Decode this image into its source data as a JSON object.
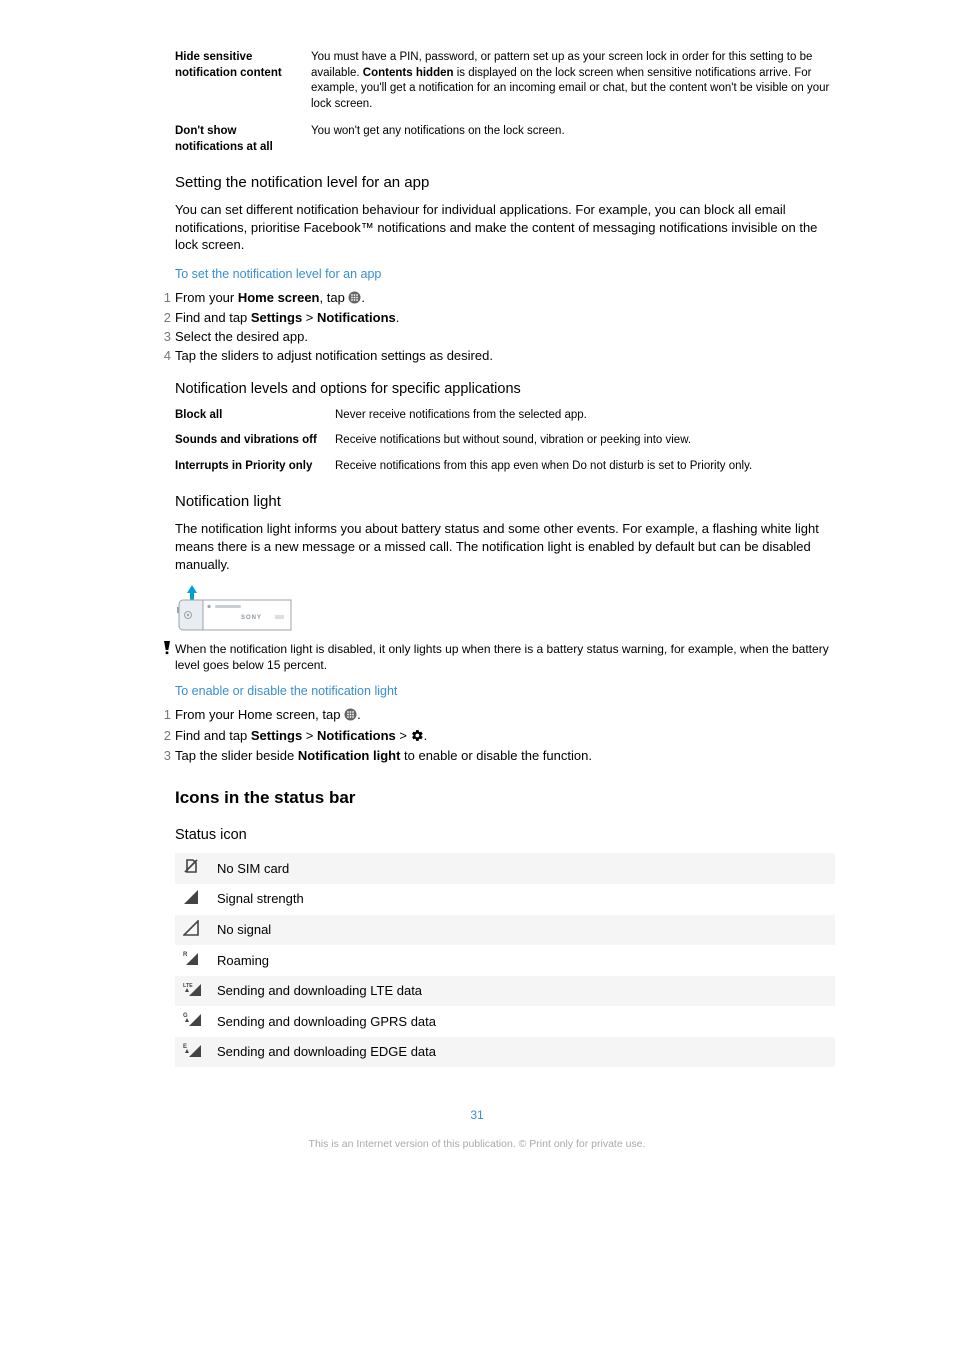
{
  "defs": [
    {
      "term": "Hide sensitive notification content",
      "body_pre": "You must have a PIN, password, or pattern set up as your screen lock in order for this setting to be available. ",
      "body_bold": "Contents hidden",
      "body_post": " is displayed on the lock screen when sensitive notifications arrive. For example, you'll get a notification for an incoming email or chat, but the content won't be visible on your lock screen."
    },
    {
      "term": "Don't show notifications at all",
      "body_pre": "You won't get any notifications on the lock screen.",
      "body_bold": "",
      "body_post": ""
    }
  ],
  "sect1": {
    "title": "Setting the notification level for an app",
    "body": "You can set different notification behaviour for individual applications. For example, you can block all email notifications, prioritise Facebook™ notifications and make the content of messaging notifications invisible on the lock screen.",
    "link": "To set the notification level for an app",
    "steps": [
      {
        "pre": "From your ",
        "b1": "Home screen",
        "mid": ", tap ",
        "icon": "apps",
        "post": "."
      },
      {
        "pre": "Find and tap ",
        "b1": "Settings",
        "mid": " > ",
        "b2": "Notifications",
        "post": "."
      },
      {
        "pre": "Select the desired app."
      },
      {
        "pre": "Tap the sliders to adjust notification settings as desired."
      }
    ]
  },
  "sect2": {
    "title": "Notification levels and options for specific applications",
    "rows": [
      {
        "term": "Block all",
        "body": "Never receive notifications from the selected app."
      },
      {
        "term": "Sounds and vibrations off",
        "body": "Receive notifications but without sound, vibration or peeking into view."
      },
      {
        "term": "Interrupts in Priority only",
        "body": "Receive notifications from this app even when Do not disturb is set to Priority only."
      }
    ]
  },
  "sect3": {
    "title": "Notification light",
    "body": "The notification light informs you about battery status and some other events. For example, a flashing white light means there is a new message or a missed call. The notification light is enabled by default but can be disabled manually.",
    "warn": "When the notification light is disabled, it only lights up when there is a battery status warning, for example, when the battery level goes below 15 percent.",
    "link": "To enable or disable the notification light",
    "steps": [
      {
        "pre": "From your Home screen, tap ",
        "icon": "apps",
        "post": "."
      },
      {
        "pre": "Find and tap ",
        "b1": "Settings",
        "mid": " > ",
        "b2": "Notifications",
        "mid2": " > ",
        "icon": "gear",
        "post": "."
      },
      {
        "pre": "Tap the slider beside ",
        "b1": "Notification light",
        "post": " to enable or disable the function."
      }
    ]
  },
  "sect4": {
    "title": "Icons in the status bar",
    "subtitle": "Status icon",
    "rows": [
      {
        "icon": "no-sim",
        "label": "No SIM card"
      },
      {
        "icon": "signal",
        "label": "Signal strength"
      },
      {
        "icon": "no-signal",
        "label": "No signal"
      },
      {
        "icon": "roaming",
        "label": "Roaming"
      },
      {
        "icon": "lte",
        "label": "Sending and downloading LTE data"
      },
      {
        "icon": "gprs",
        "label": "Sending and downloading GPRS data"
      },
      {
        "icon": "edge",
        "label": "Sending and downloading EDGE data"
      }
    ]
  },
  "page_number": "31",
  "footer": "This is an Internet version of this publication. © Print only for private use."
}
